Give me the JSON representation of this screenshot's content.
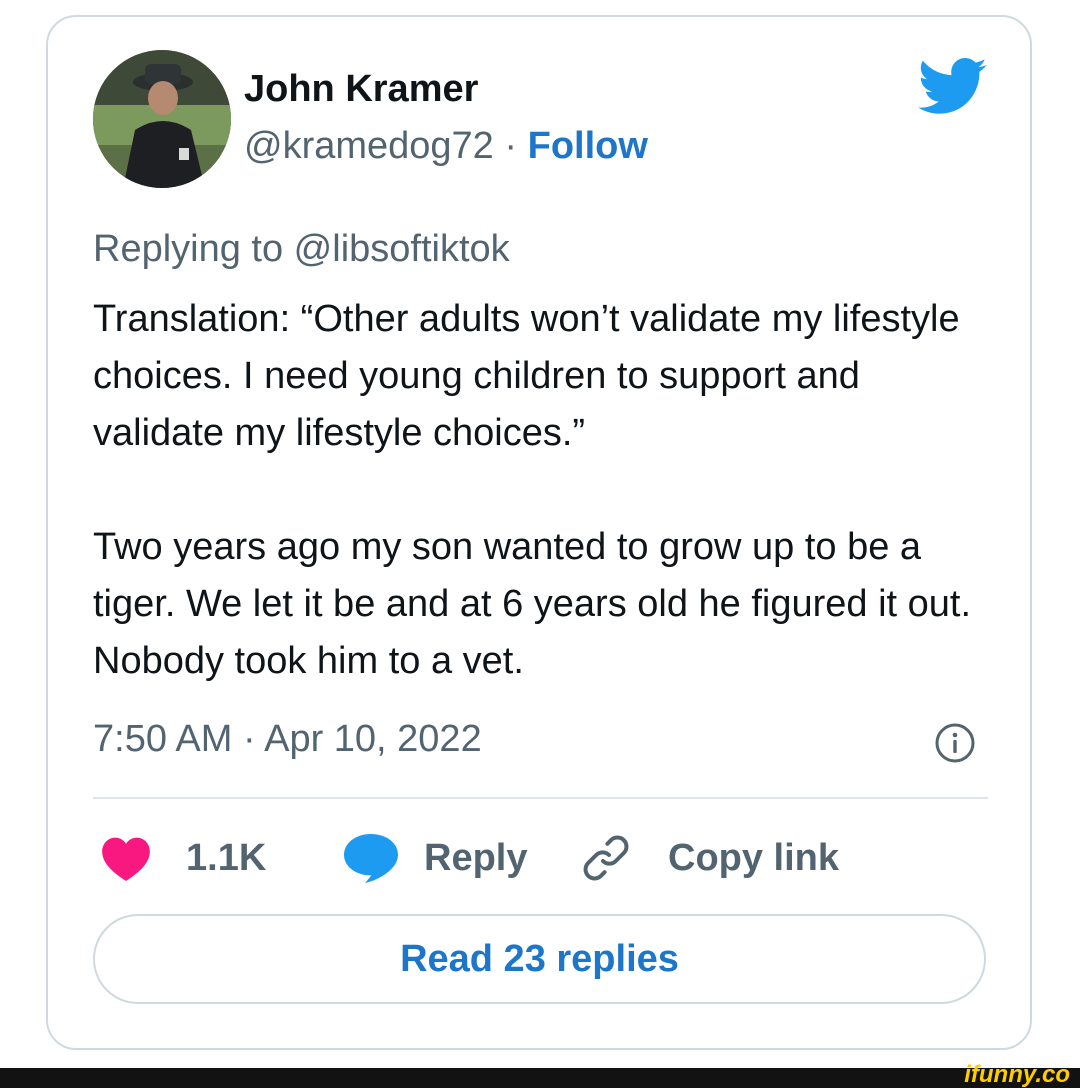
{
  "tweet": {
    "author": {
      "name": "John Kramer",
      "handle": "@kramedog72",
      "separator": " · ",
      "follow_label": "Follow"
    },
    "platform_icon": "twitter-bird-icon",
    "replying_prefix": "Replying to ",
    "replying_to": "@libsoftiktok",
    "text_paragraph_1": "Translation: “Other adults won’t validate my lifestyle choices. I need young children to support and validate my lifestyle choices.”",
    "text_paragraph_2": "Two years ago my son wanted to grow up to be a tiger. We let it be and at 6 years old he figured it out. Nobody took him to a vet.",
    "timestamp": "7:50 AM · Apr 10, 2022",
    "actions": {
      "likes": "1.1K",
      "reply_label": "Reply",
      "copy_link_label": "Copy link"
    },
    "read_replies_label": "Read 23 replies"
  },
  "watermark": "ifunny.co",
  "colors": {
    "link_blue": "#1d76c8",
    "twitter_blue": "#1d9bf0",
    "heart_pink": "#f91880",
    "muted_text": "#536471",
    "border": "#cfd9de"
  }
}
